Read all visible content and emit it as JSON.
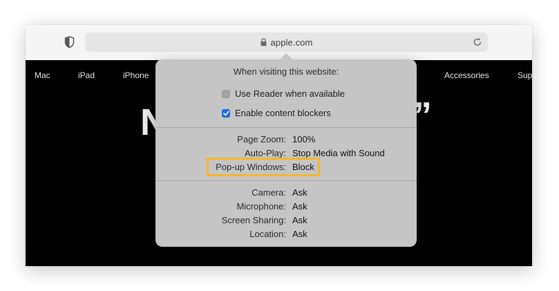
{
  "browser": {
    "url": "apple.com",
    "icons": {
      "shield": "shield-icon",
      "lock": "lock-icon",
      "reload": "reload-icon"
    }
  },
  "site_nav": {
    "items": [
      "Mac",
      "iPad",
      "iPhone",
      "Accessories",
      "Sup"
    ]
  },
  "hero": {
    "left_fragment": "N",
    "right_fragment": "”"
  },
  "popover": {
    "title": "When visiting this website:",
    "checkboxes": [
      {
        "label": "Use Reader when available",
        "checked": false
      },
      {
        "label": "Enable content blockers",
        "checked": true
      }
    ],
    "page_settings": [
      {
        "label": "Page Zoom:",
        "value": "100%"
      },
      {
        "label": "Auto-Play:",
        "value": "Stop Media with Sound"
      },
      {
        "label": "Pop-up Windows:",
        "value": "Block",
        "highlighted": true
      }
    ],
    "permissions": [
      {
        "label": "Camera:",
        "value": "Ask"
      },
      {
        "label": "Microphone:",
        "value": "Ask"
      },
      {
        "label": "Screen Sharing:",
        "value": "Ask"
      },
      {
        "label": "Location:",
        "value": "Ask"
      }
    ]
  },
  "colors": {
    "highlight": "#f5b52e",
    "checkbox_on": "#1f6fe5",
    "page_background": "#000000"
  }
}
